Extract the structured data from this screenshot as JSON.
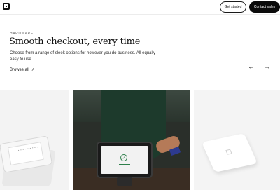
{
  "header": {
    "logo": "square-logo-icon",
    "get_started_label": "Get started",
    "contact_sales_label": "Contact sales"
  },
  "hero": {
    "eyebrow": "HARDWARE",
    "title": "Smooth checkout, every time",
    "description": "Choose from a range of sleek options for however you do business. All equally easy to use.",
    "browse_label": "Browse all",
    "browse_icon": "arrow-up-right-icon",
    "prev_icon": "arrow-left-icon",
    "next_icon": "arrow-right-icon"
  },
  "products": [
    {
      "name": "register-device-image"
    },
    {
      "name": "terminal-in-use-photo"
    },
    {
      "name": "reader-device-image"
    }
  ],
  "colors": {
    "primary": "#0b0b0b",
    "background": "#ffffff",
    "card_bg": "#f3f3f3"
  }
}
